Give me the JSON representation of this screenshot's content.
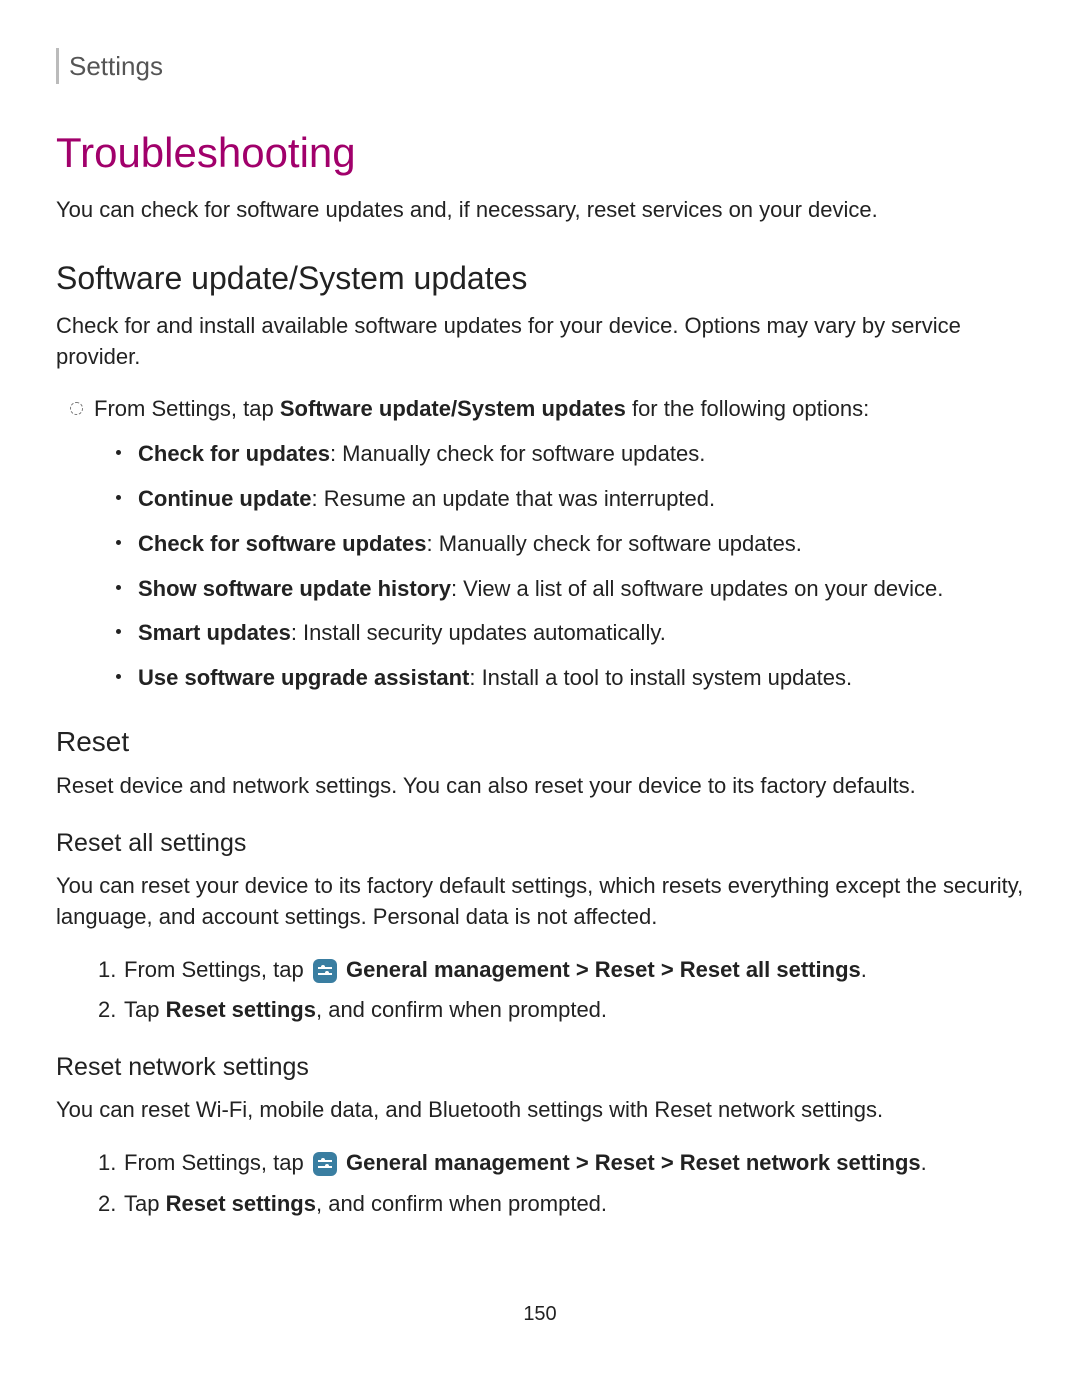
{
  "breadcrumb": "Settings",
  "h1": "Troubleshooting",
  "intro": "You can check for software updates and, if necessary, reset services on your device.",
  "sw": {
    "heading": "Software update/System updates",
    "desc": "Check for and install available software updates for your device. Options may vary by service provider.",
    "lead_prefix": "From Settings, tap ",
    "lead_bold": "Software update/System updates",
    "lead_suffix": " for the following options:",
    "items": [
      {
        "term": "Check for updates",
        "desc": ": Manually check for software updates."
      },
      {
        "term": "Continue update",
        "desc": ": Resume an update that was interrupted."
      },
      {
        "term": "Check for software updates",
        "desc": ": Manually check for software updates."
      },
      {
        "term": "Show software update history",
        "desc": ": View a list of all software updates on your device."
      },
      {
        "term": "Smart updates",
        "desc": ": Install security updates automatically."
      },
      {
        "term": "Use software upgrade assistant",
        "desc": ": Install a tool to install system updates."
      }
    ]
  },
  "reset": {
    "heading": "Reset",
    "desc": "Reset device and network settings. You can also reset your device to its factory defaults.",
    "all": {
      "heading": "Reset all settings",
      "desc": "You can reset your device to its factory default settings, which resets everything except the security, language, and account settings. Personal data is not affected.",
      "step1_prefix": "From Settings, tap ",
      "step1_path": " General management > Reset > Reset all settings",
      "step1_end": ".",
      "step2_prefix": "Tap ",
      "step2_bold": "Reset settings",
      "step2_suffix": ", and confirm when prompted."
    },
    "net": {
      "heading": "Reset network settings",
      "desc": "You can reset Wi-Fi, mobile data, and Bluetooth settings with Reset network settings.",
      "step1_prefix": "From Settings, tap ",
      "step1_path": " General management > Reset > Reset network settings",
      "step1_end": ".",
      "step2_prefix": "Tap ",
      "step2_bold": "Reset settings",
      "step2_suffix": ", and confirm when prompted."
    }
  },
  "page_number": "150",
  "num": {
    "one": "1.",
    "two": "2."
  }
}
